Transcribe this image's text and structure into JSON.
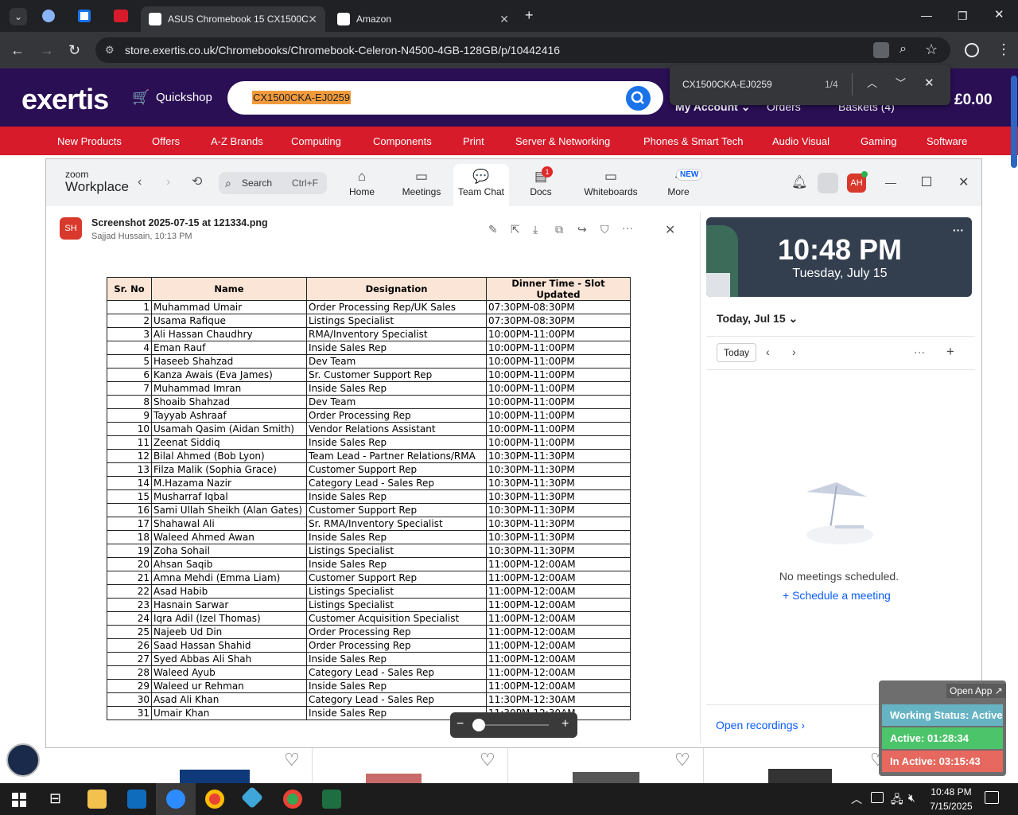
{
  "browser": {
    "tabs": [
      {
        "title": "ASUS Chromebook 15 CX1500C",
        "active": true
      },
      {
        "title": "Amazon",
        "active": false
      }
    ],
    "url": "store.exertis.co.uk/Chromebooks/Chromebook-Celeron-N4500-4GB-128GB/p/10442416",
    "find": {
      "query": "CX1500CKA-EJ0259",
      "count": "1/4"
    }
  },
  "site": {
    "logo": "exertis",
    "quickshop": "Quickshop",
    "search_value": "CX1500CKA-EJ0259",
    "account": "My Account",
    "orders": "Orders",
    "baskets": "Baskets (4)",
    "total": "£0.00",
    "categories": [
      "New Products",
      "Offers",
      "A-Z Brands",
      "Computing",
      "Components",
      "Print",
      "Server & Networking",
      "Phones & Smart Tech",
      "Audio Visual",
      "Gaming",
      "Software"
    ]
  },
  "zoom": {
    "brand_small": "zoom",
    "brand": "Workplace",
    "search_label": "Search",
    "search_shortcut": "Ctrl+F",
    "tabs": [
      {
        "label": "Home",
        "icon": "home-icon"
      },
      {
        "label": "Meetings",
        "icon": "video-icon"
      },
      {
        "label": "Team Chat",
        "icon": "chat-icon"
      },
      {
        "label": "Docs",
        "icon": "docs-icon",
        "badge": "1"
      },
      {
        "label": "Whiteboards",
        "icon": "whiteboard-icon"
      },
      {
        "label": "More",
        "icon": "more-icon",
        "badge": "NEW"
      }
    ],
    "avatar": "AH",
    "file": {
      "avatar": "SH",
      "name": "Screenshot 2025-07-15 at 121334.png",
      "meta": "Sajjad Hussain, 10:13 PM"
    },
    "clock": {
      "time": "10:48 PM",
      "date": "Tuesday, July 15"
    },
    "calendar": {
      "header": "Today, Jul 15",
      "today_btn": "Today",
      "empty": "No meetings scheduled.",
      "schedule": "Schedule a meeting",
      "recordings": "Open recordings"
    }
  },
  "table": {
    "headers": [
      "Sr. No",
      "Name",
      "Designation",
      "Dinner Time - Slot Updated"
    ],
    "rows": [
      [
        "1",
        "Muhammad Umair",
        "Order Processing Rep/UK Sales",
        "07:30PM-08:30PM"
      ],
      [
        "2",
        "Usama Rafique",
        "Listings Specialist",
        "07:30PM-08:30PM"
      ],
      [
        "3",
        "Ali Hassan Chaudhry",
        "RMA/Inventory Specialist",
        "10:00PM-11:00PM"
      ],
      [
        "4",
        "Eman Rauf",
        "Inside Sales Rep",
        "10:00PM-11:00PM"
      ],
      [
        "5",
        "Haseeb Shahzad",
        "Dev Team",
        "10:00PM-11:00PM"
      ],
      [
        "6",
        "Kanza Awais (Eva James)",
        "Sr. Customer Support Rep",
        "10:00PM-11:00PM"
      ],
      [
        "7",
        "Muhammad Imran",
        "Inside Sales Rep",
        "10:00PM-11:00PM"
      ],
      [
        "8",
        "Shoaib Shahzad",
        "Dev Team",
        "10:00PM-11:00PM"
      ],
      [
        "9",
        "Tayyab Ashraaf",
        "Order Processing Rep",
        "10:00PM-11:00PM"
      ],
      [
        "10",
        "Usamah Qasim (Aidan Smith)",
        "Vendor Relations Assistant",
        "10:00PM-11:00PM"
      ],
      [
        "11",
        "Zeenat Siddiq",
        "Inside Sales Rep",
        "10:00PM-11:00PM"
      ],
      [
        "12",
        "Bilal Ahmed (Bob Lyon)",
        "Team Lead - Partner Relations/RMA",
        "10:30PM-11:30PM"
      ],
      [
        "13",
        "Filza Malik (Sophia Grace)",
        "Customer Support Rep",
        "10:30PM-11:30PM"
      ],
      [
        "14",
        "M.Hazama Nazir",
        "Category Lead - Sales Rep",
        "10:30PM-11:30PM"
      ],
      [
        "15",
        "Musharraf Iqbal",
        "Inside Sales Rep",
        "10:30PM-11:30PM"
      ],
      [
        "16",
        "Sami Ullah Sheikh (Alan Gates)",
        "Customer Support Rep",
        "10:30PM-11:30PM"
      ],
      [
        "17",
        "Shahawal Ali",
        "Sr. RMA/Inventory Specialist",
        "10:30PM-11:30PM"
      ],
      [
        "18",
        "Waleed Ahmed Awan",
        "Inside Sales Rep",
        "10:30PM-11:30PM"
      ],
      [
        "19",
        "Zoha Sohail",
        "Listings Specialist",
        "10:30PM-11:30PM"
      ],
      [
        "20",
        "Ahsan Saqib",
        "Inside Sales Rep",
        "11:00PM-12:00AM"
      ],
      [
        "21",
        "Amna Mehdi (Emma Liam)",
        "Customer Support Rep",
        "11:00PM-12:00AM"
      ],
      [
        "22",
        "Asad Habib",
        "Listings Specialist",
        "11:00PM-12:00AM"
      ],
      [
        "23",
        "Hasnain Sarwar",
        "Listings Specialist",
        "11:00PM-12:00AM"
      ],
      [
        "24",
        "Iqra Adil (Izel Thomas)",
        "Customer Acquisition Specialist",
        "11:00PM-12:00AM"
      ],
      [
        "25",
        "Najeeb Ud Din",
        "Order Processing Rep",
        "11:00PM-12:00AM"
      ],
      [
        "26",
        "Saad Hassan Shahid",
        "Order Processing Rep",
        "11:00PM-12:00AM"
      ],
      [
        "27",
        "Syed Abbas Ali Shah",
        "Inside Sales Rep",
        "11:00PM-12:00AM"
      ],
      [
        "28",
        "Waleed Ayub",
        "Category Lead - Sales Rep",
        "11:00PM-12:00AM"
      ],
      [
        "29",
        "Waleed ur Rehman",
        "Inside Sales Rep",
        "11:00PM-12:00AM"
      ],
      [
        "30",
        "Asad Ali Khan",
        "Category Lead - Sales Rep",
        "11:30PM-12:30AM"
      ],
      [
        "31",
        "Umair Khan",
        "Inside Sales Rep",
        "11:30PM-12:30AM"
      ]
    ]
  },
  "widget": {
    "open_app": "Open App ↗",
    "status": "Working Status: Active",
    "active": "Active: 01:28:34",
    "inactive": "In Active: 03:15:43"
  },
  "taskbar": {
    "time": "10:48 PM",
    "date": "7/15/2025"
  }
}
